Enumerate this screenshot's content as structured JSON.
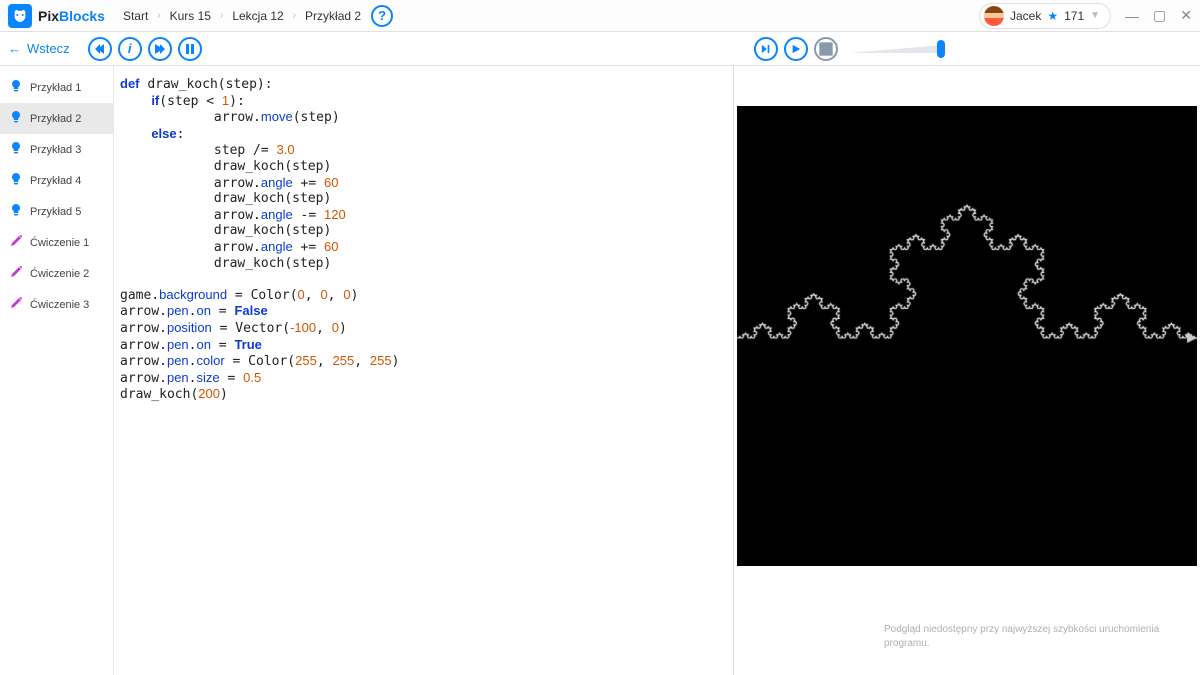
{
  "brand": {
    "prefix": "Pix",
    "suffix": "Blocks"
  },
  "breadcrumbs": [
    "Start",
    "Kurs 15",
    "Lekcja 12",
    "Przykład 2"
  ],
  "help_label": "?",
  "user": {
    "name": "Jacek",
    "points": "171"
  },
  "back_label": "Wstecz",
  "sidebar": {
    "items": [
      {
        "label": "Przykład 1",
        "icon": "bulb",
        "active": false
      },
      {
        "label": "Przykład 2",
        "icon": "bulb",
        "active": true
      },
      {
        "label": "Przykład 3",
        "icon": "bulb",
        "active": false
      },
      {
        "label": "Przykład 4",
        "icon": "bulb",
        "active": false
      },
      {
        "label": "Przykład 5",
        "icon": "bulb",
        "active": false
      },
      {
        "label": "Ćwiczenie 1",
        "icon": "pencil",
        "active": false
      },
      {
        "label": "Ćwiczenie 2",
        "icon": "pencil",
        "active": false
      },
      {
        "label": "Ćwiczenie 3",
        "icon": "pencil",
        "active": false
      }
    ]
  },
  "code": {
    "def": "def",
    "fname": "draw_koch",
    "param": "step",
    "if": "if",
    "lt": "<",
    "one": "1",
    "arrow": "arrow",
    "move": "move",
    "else": "else",
    "divop": "/=",
    "three": "3.0",
    "angle": "angle",
    "pluseq": "+=",
    "sixty": "60",
    "minuseq": "-=",
    "onetwenty": "120",
    "game": "game",
    "background": "background",
    "Color": "Color",
    "zero": "0",
    "pen": "pen",
    "on": "on",
    "False": "False",
    "True": "True",
    "position": "position",
    "Vector": "Vector",
    "neg100": "-100",
    "color": "color",
    "c255": "255",
    "size": "size",
    "half": "0.5",
    "twohundred": "200"
  },
  "footer": "Podgląd niedostępny przy najwyższej szybkości uruchomienia programu."
}
